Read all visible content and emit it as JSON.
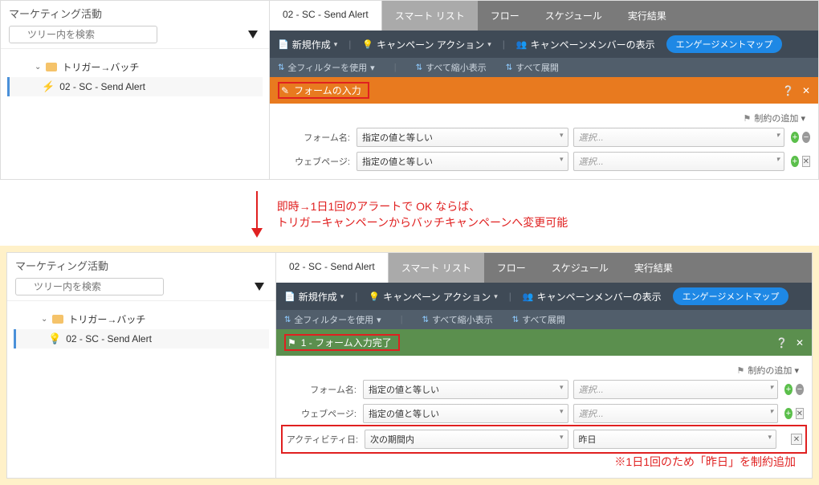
{
  "sidebar": {
    "title": "マーケティング活動",
    "search_placeholder": "ツリー内を検索",
    "folder_label": "トリガー→バッチ",
    "item_label": "02 - SC - Send Alert"
  },
  "tabs": {
    "title": "02 - SC - Send Alert",
    "smartlist": "スマート リスト",
    "flow": "フロー",
    "schedule": "スケジュール",
    "results": "実行結果"
  },
  "toolbar": {
    "new": "新規作成",
    "campaign_actions": "キャンペーン アクション",
    "show_members": "キャンペーンメンバーの表示",
    "engagement_map": "エンゲージメントマップ"
  },
  "subbar": {
    "use_all_filters": "全フィルターを使用",
    "collapse_all": "すべて縮小表示",
    "expand_all": "すべて展開"
  },
  "trigger": {
    "header": "フォームの入力",
    "constraint_add": "制約の追加",
    "rows": [
      {
        "label": "フォーム名:",
        "op": "指定の値と等しい",
        "val": "選択..."
      },
      {
        "label": "ウェブページ:",
        "op": "指定の値と等しい",
        "val": "選択..."
      }
    ]
  },
  "annot": {
    "line1": "即時→1日1回のアラートで OK ならば、",
    "line2": "トリガーキャンペーンからバッチキャンペーンへ変更可能"
  },
  "batch": {
    "header": "1 - フォーム入力完了",
    "constraint_add": "制約の追加",
    "rows": [
      {
        "label": "フォーム名:",
        "op": "指定の値と等しい",
        "val": "選択..."
      },
      {
        "label": "ウェブページ:",
        "op": "指定の値と等しい",
        "val": "選択..."
      },
      {
        "label": "アクティビティ日:",
        "op": "次の期間内",
        "val": "昨日"
      }
    ],
    "footnote": "※1日1回のため「昨日」を制約追加"
  }
}
